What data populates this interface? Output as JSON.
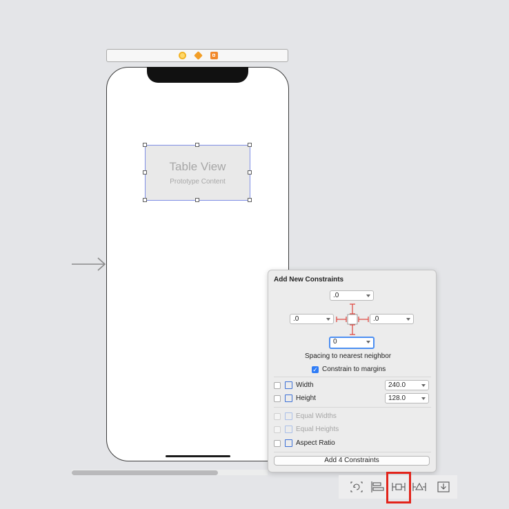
{
  "canvas": {
    "scene_dock": {
      "icons": [
        "view-controller-icon",
        "first-responder-icon",
        "exit-icon"
      ]
    },
    "table_view": {
      "title": "Table View",
      "subtitle": "Prototype Content"
    }
  },
  "popover": {
    "title": "Add New Constraints",
    "top_value": ".0",
    "left_value": ".0",
    "right_value": ".0",
    "bottom_value": "0",
    "spacing_label": "Spacing to nearest neighbor",
    "constrain_to_margins": {
      "label": "Constrain to margins",
      "checked": true
    },
    "width": {
      "label": "Width",
      "value": "240.0",
      "checked": false
    },
    "height": {
      "label": "Height",
      "value": "128.0",
      "checked": false
    },
    "equal_widths": {
      "label": "Equal Widths",
      "enabled": false
    },
    "equal_heights": {
      "label": "Equal Heights",
      "enabled": false
    },
    "aspect_ratio": {
      "label": "Aspect Ratio",
      "checked": false
    },
    "add_button_label": "Add 4 Constraints",
    "strut_color": "#e0413a"
  },
  "toolbar": {
    "icons": [
      "update-frames-icon",
      "align-icon",
      "add-constraints-icon",
      "resolve-issues-icon",
      "embed-in-icon"
    ],
    "highlight_color": "#e2231a"
  }
}
